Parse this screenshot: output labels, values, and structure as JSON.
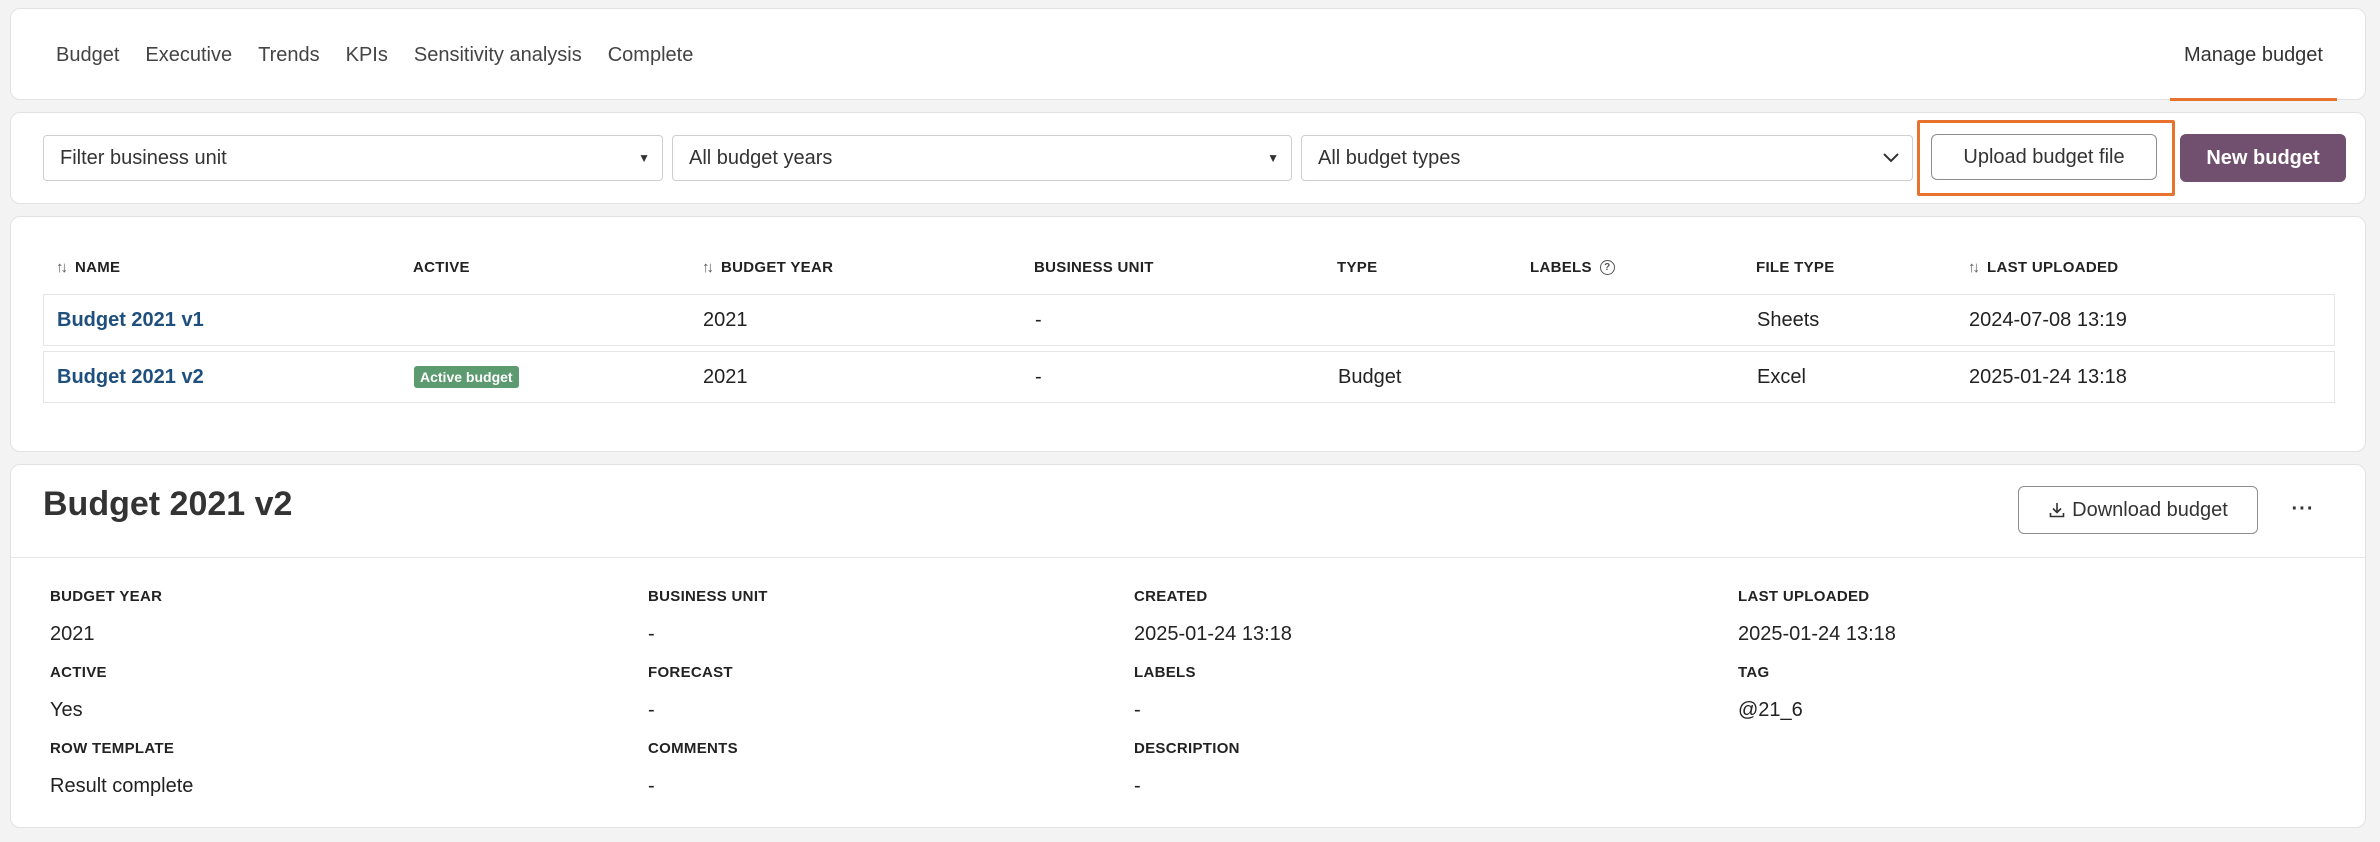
{
  "nav": {
    "tabs": [
      "Budget",
      "Executive",
      "Trends",
      "KPIs",
      "Sensitivity analysis",
      "Complete"
    ],
    "manage_label": "Manage budget"
  },
  "filters": {
    "business_unit_placeholder": "Filter business unit",
    "budget_years_value": "All budget years",
    "budget_types_value": "All budget types",
    "upload_label": "Upload budget file",
    "new_label": "New budget"
  },
  "table": {
    "headers": {
      "name": "NAME",
      "active": "ACTIVE",
      "budget_year": "BUDGET YEAR",
      "business_unit": "BUSINESS UNIT",
      "type": "TYPE",
      "labels": "LABELS",
      "file_type": "FILE TYPE",
      "last_uploaded": "LAST UPLOADED"
    },
    "rows": [
      {
        "name": "Budget 2021 v1",
        "active": "",
        "budget_year": "2021",
        "business_unit": "-",
        "type": "",
        "labels": "",
        "file_type": "Sheets",
        "last_uploaded": "2024-07-08 13:19"
      },
      {
        "name": "Budget 2021 v2",
        "active": "Active budget",
        "budget_year": "2021",
        "business_unit": "-",
        "type": "Budget",
        "labels": "",
        "file_type": "Excel",
        "last_uploaded": "2025-01-24 13:18"
      }
    ]
  },
  "detail": {
    "title": "Budget 2021 v2",
    "download_label": "Download budget",
    "more_label": "···",
    "fields": [
      {
        "label": "BUDGET YEAR",
        "value": "2021"
      },
      {
        "label": "BUSINESS UNIT",
        "value": "-"
      },
      {
        "label": "CREATED",
        "value": "2025-01-24 13:18"
      },
      {
        "label": "LAST UPLOADED",
        "value": "2025-01-24 13:18"
      },
      {
        "label": "ACTIVE",
        "value": "Yes"
      },
      {
        "label": "FORECAST",
        "value": "-"
      },
      {
        "label": "LABELS",
        "value": "-"
      },
      {
        "label": "TAG",
        "value": "@21_6"
      },
      {
        "label": "ROW TEMPLATE",
        "value": "Result complete"
      },
      {
        "label": "COMMENTS",
        "value": "-"
      },
      {
        "label": "DESCRIPTION",
        "value": "-"
      }
    ]
  },
  "colors": {
    "accent": "#e8732f",
    "primary_button": "#70506e",
    "link": "#1f4f7d",
    "active_badge": "#5c9a6f"
  }
}
